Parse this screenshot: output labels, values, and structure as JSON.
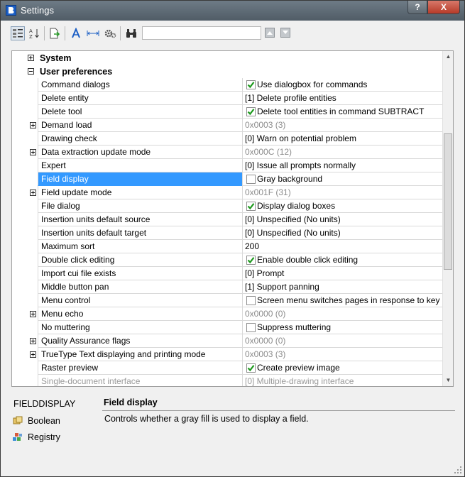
{
  "window": {
    "title": "Settings",
    "help_label": "?",
    "close_label": "X"
  },
  "toolbar": {
    "search": {
      "value": "",
      "placeholder": ""
    }
  },
  "groups": [
    {
      "label": "System",
      "expanded": false
    },
    {
      "label": "User preferences",
      "expanded": true
    }
  ],
  "rows": [
    {
      "name": "Command dialogs",
      "value": "Use dialogbox for commands",
      "type": "checkbox",
      "checked": true,
      "expandable": false
    },
    {
      "name": "Delete entity",
      "value": "[1] Delete profile entities",
      "type": "text",
      "expandable": false
    },
    {
      "name": "Delete tool",
      "value": "Delete tool entities in command SUBTRACT",
      "type": "checkbox",
      "checked": true,
      "expandable": false
    },
    {
      "name": "Demand load",
      "value": "0x0003 (3)",
      "type": "gray",
      "expandable": true
    },
    {
      "name": "Drawing check",
      "value": "[0] Warn on potential problem",
      "type": "text",
      "expandable": false
    },
    {
      "name": "Data extraction update mode",
      "value": "0x000C (12)",
      "type": "gray",
      "expandable": true
    },
    {
      "name": "Expert",
      "value": "[0] Issue all prompts normally",
      "type": "text",
      "expandable": false
    },
    {
      "name": "Field display",
      "value": "Gray background",
      "type": "checkbox",
      "checked": false,
      "expandable": false,
      "selected": true
    },
    {
      "name": "Field update mode",
      "value": "0x001F (31)",
      "type": "gray",
      "expandable": true
    },
    {
      "name": "File dialog",
      "value": "Display dialog boxes",
      "type": "checkbox",
      "checked": true,
      "expandable": false
    },
    {
      "name": "Insertion units default source",
      "value": "[0] Unspecified (No units)",
      "type": "text",
      "expandable": false
    },
    {
      "name": "Insertion units default target",
      "value": "[0] Unspecified (No units)",
      "type": "text",
      "expandable": false
    },
    {
      "name": "Maximum sort",
      "value": "200",
      "type": "text",
      "expandable": false
    },
    {
      "name": "Double click editing",
      "value": "Enable double click editing",
      "type": "checkbox",
      "checked": true,
      "expandable": false
    },
    {
      "name": "Import cui file exists",
      "value": "[0] Prompt",
      "type": "text",
      "expandable": false
    },
    {
      "name": "Middle button pan",
      "value": "[1] Support panning",
      "type": "text",
      "expandable": false
    },
    {
      "name": "Menu control",
      "value": "Screen menu switches pages in response to key",
      "type": "checkbox",
      "checked": false,
      "expandable": false
    },
    {
      "name": "Menu echo",
      "value": "0x0000 (0)",
      "type": "gray",
      "expandable": true
    },
    {
      "name": "No muttering",
      "value": "Suppress muttering",
      "type": "checkbox",
      "checked": false,
      "expandable": false
    },
    {
      "name": "Quality Assurance flags",
      "value": "0x0000 (0)",
      "type": "gray",
      "expandable": true
    },
    {
      "name": "TrueType Text displaying and printing mode",
      "value": "0x0003 (3)",
      "type": "gray",
      "expandable": true
    },
    {
      "name": "Raster preview",
      "value": "Create preview image",
      "type": "checkbox",
      "checked": true,
      "expandable": false
    },
    {
      "name": "Single-document interface",
      "value": "[0] Multiple-drawing interface",
      "type": "text",
      "expandable": false,
      "disabled": true
    }
  ],
  "description": {
    "variable": "FIELDDISPLAY",
    "value_type": "Boolean",
    "storage": "Registry",
    "title": "Field display",
    "text": "Controls whether a gray fill is used to display a field."
  }
}
